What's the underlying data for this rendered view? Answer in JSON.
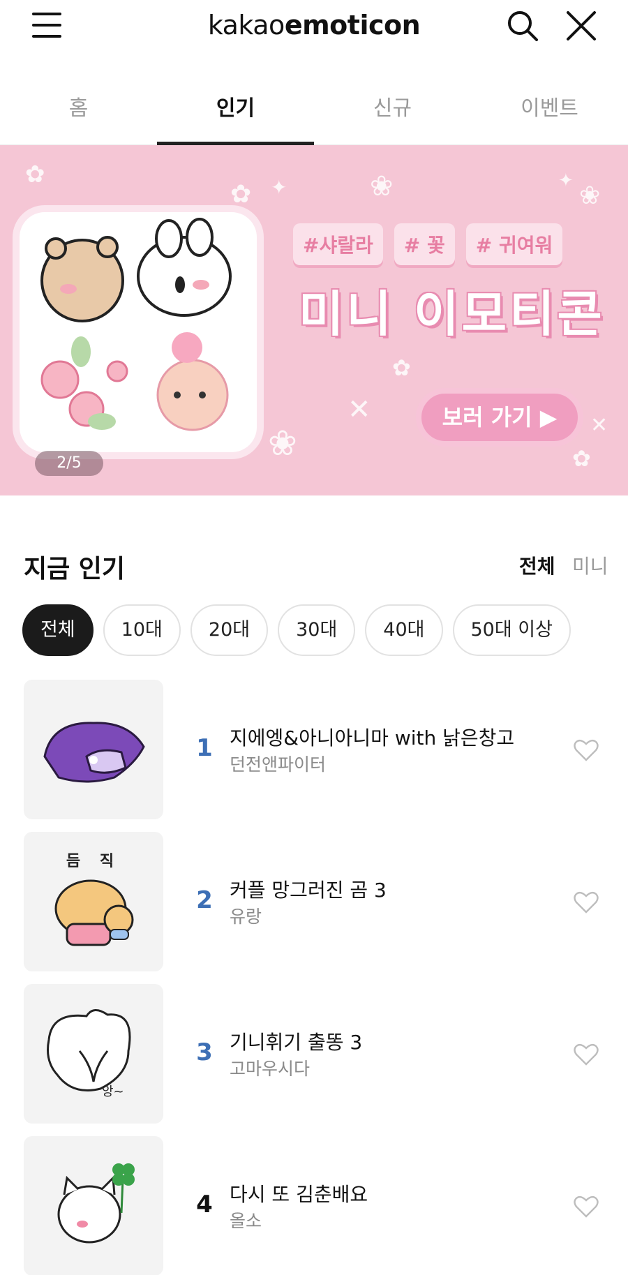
{
  "header": {
    "logo_part1": "kakao",
    "logo_part2": "emoticon",
    "menu_icon": "hamburger-icon",
    "search_icon": "search-icon",
    "close_icon": "close-icon"
  },
  "tabs": [
    {
      "label": "홈",
      "active": false
    },
    {
      "label": "인기",
      "active": true
    },
    {
      "label": "신규",
      "active": false
    },
    {
      "label": "이벤트",
      "active": false
    }
  ],
  "banner": {
    "tags": [
      "#샤랄라",
      "# 꽃",
      "# 귀여워"
    ],
    "title": "미니 이모티콘",
    "button_label": "보러 가기 ▶",
    "pager": "2/5",
    "bg_color": "#f5c6d5"
  },
  "popular": {
    "title": "지금 인기",
    "filter_all": "전체",
    "filter_mini": "미니",
    "chips": [
      {
        "label": "전체",
        "active": true
      },
      {
        "label": "10대",
        "active": false
      },
      {
        "label": "20대",
        "active": false
      },
      {
        "label": "30대",
        "active": false
      },
      {
        "label": "40대",
        "active": false
      },
      {
        "label": "50대 이상",
        "active": false
      }
    ],
    "items": [
      {
        "rank": "1",
        "title": "지에엥&아니아니마 with 낡은창고",
        "author": "던전앤파이터"
      },
      {
        "rank": "2",
        "title": "커플 망그러진 곰 3",
        "author": "유랑",
        "thumb_caption": "듬 직"
      },
      {
        "rank": "3",
        "title": "기니휘기 출똥 3",
        "author": "고마우시다",
        "thumb_caption": "앙~"
      },
      {
        "rank": "4",
        "title": "다시 또 김춘배요",
        "author": "올소"
      }
    ]
  },
  "colors": {
    "rank_accent": "#3d6fb5",
    "chip_active": "#1b1b1b",
    "banner_pink": "#f5c6d5"
  }
}
